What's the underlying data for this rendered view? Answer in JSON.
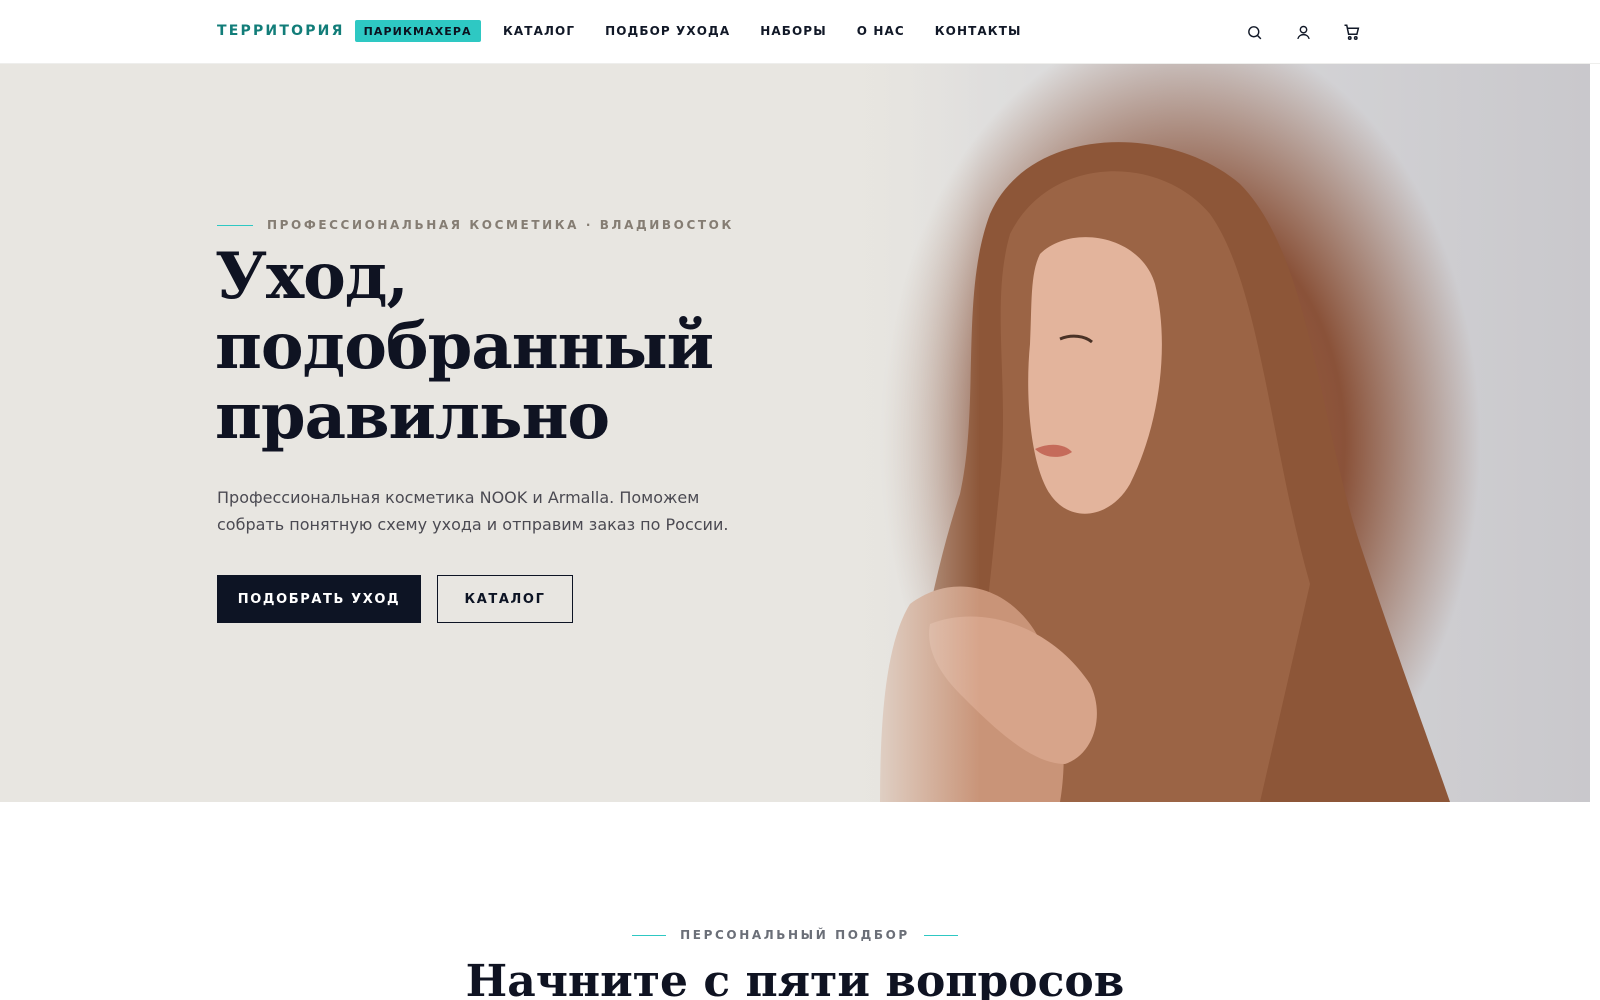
{
  "header": {
    "logo_text": "ТЕРРИТОРИЯ",
    "logo_badge": "ПАРИКМАХЕРА",
    "nav": [
      {
        "label": "КАТАЛОГ"
      },
      {
        "label": "ПОДБОР УХОДА"
      },
      {
        "label": "НАБОРЫ"
      },
      {
        "label": "О НАС"
      },
      {
        "label": "КОНТАКТЫ"
      }
    ],
    "icons": [
      "search-icon",
      "user-icon",
      "cart-icon"
    ]
  },
  "hero": {
    "eyebrow": "ПРОФЕССИОНАЛЬНАЯ КОСМЕТИКА · ВЛАДИВОСТОК",
    "headline_lines": [
      "Уход,",
      "подобранный",
      "правильно"
    ],
    "lead": "Профессиональная косметика NOOK и Armalla. Поможем собрать понятную схему ухода и отправим заказ по России.",
    "primary_button": "ПОДОБРАТЬ УХОД",
    "secondary_button": "КАТАЛОГ"
  },
  "section": {
    "eyebrow": "ПЕРСОНАЛЬНЫЙ ПОДБОР",
    "title": "Начните с пяти вопросов"
  },
  "colors": {
    "accent": "#2ec8c3",
    "brand": "#127d79",
    "dark": "#0d1424",
    "hero_bg": "#e8e6e1"
  }
}
